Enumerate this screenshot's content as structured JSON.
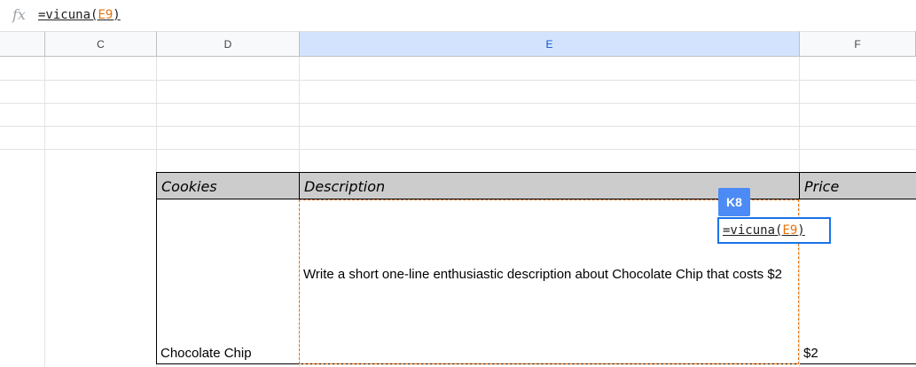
{
  "formula_bar": {
    "fx_label": "fx",
    "formula_prefix": "=vicuna(",
    "formula_ref": "E9",
    "formula_suffix": ")"
  },
  "columns": {
    "c": "C",
    "d": "D",
    "e": "E",
    "f": "F"
  },
  "selected_column": "E",
  "table": {
    "headers": {
      "cookies": "Cookies",
      "description": "Description",
      "price": "Price"
    },
    "row": {
      "cookie": "Chocolate Chip",
      "description": "Write a short one-line enthusiastic description about Chocolate Chip  that costs $2",
      "price": "$2"
    }
  },
  "cell_editor": {
    "cell_ref": "K8",
    "formula_prefix": "=vicuna(",
    "formula_ref": "E9",
    "formula_suffix": ")"
  },
  "colors": {
    "selected_header_bg": "#d3e3fd",
    "reference_orange": "#e8710a",
    "editor_blue": "#1a73e8",
    "cell_badge": "#4c8bf5",
    "table_header_bg": "#cccccc"
  }
}
